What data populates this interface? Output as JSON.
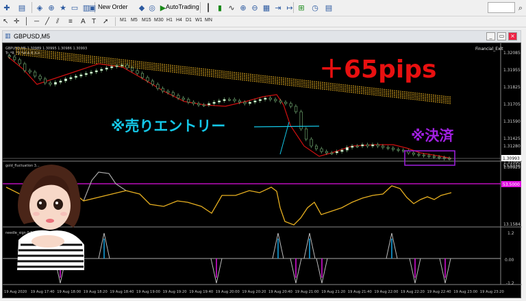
{
  "toolbar": {
    "new_order": "New Order",
    "autotrading": "AutoTrading",
    "timeframes": [
      "M1",
      "M5",
      "M15",
      "M30",
      "H1",
      "H4",
      "D1",
      "W1",
      "MN"
    ]
  },
  "window": {
    "title": "GBPUSD,M5"
  },
  "chart": {
    "main_indicator_label": "Financial_Exit",
    "header_line1": "GBPUSD,M5  1.30989 1.30995 1.30986 1.30993",
    "header_line2": "Tr_*R_*V-*W A A A A",
    "price_labels": [
      "1.32085",
      "1.31955",
      "1.31825",
      "1.31705",
      "1.31590",
      "1.31425",
      "1.31280",
      "1.31090",
      "1.30925"
    ],
    "current_price": "1.30993",
    "annotation_gain": "＋65pips",
    "annotation_entry": "※売りエントリー",
    "annotation_exit": "※決済",
    "colors": {
      "gain": "#e81010",
      "entry": "#14c8e8",
      "exit": "#a020e0",
      "bull_candle": "#ffffff",
      "ma_band": "#e8b020",
      "ma_red": "#d01010"
    }
  },
  "sub1": {
    "label": "gold_fluctuation 3...",
    "top_value": "53.8336",
    "level_value": "53.5000",
    "bottom_value": "13.1584"
  },
  "sub2": {
    "label": "needle_sign 0.1...",
    "values": [
      "1.2",
      "0.00",
      "-1.2"
    ]
  },
  "time_labels": [
    "19 Aug 2020",
    "19 Aug 17:40",
    "19 Aug 18:00",
    "19 Aug 18:20",
    "19 Aug 18:40",
    "19 Aug 19:00",
    "19 Aug 19:20",
    "19 Aug 19:40",
    "19 Aug 20:00",
    "19 Aug 20:20",
    "19 Aug 20:40",
    "19 Aug 21:00",
    "19 Aug 21:20",
    "19 Aug 21:40",
    "19 Aug 22:00",
    "19 Aug 22:20",
    "19 Aug 22:40",
    "19 Aug 23:00",
    "19 Aug 23:20"
  ]
}
